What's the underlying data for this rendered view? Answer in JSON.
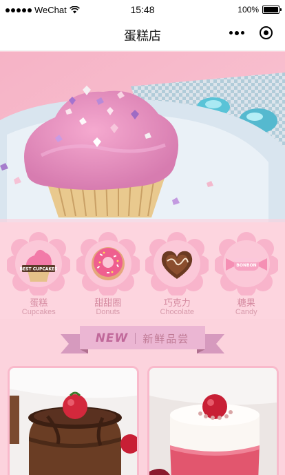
{
  "status_bar": {
    "carrier": "WeChat",
    "time": "15:48",
    "battery": "100%"
  },
  "nav": {
    "title": "蛋糕店"
  },
  "categories": [
    {
      "label_cn": "蛋糕",
      "label_en": "Cupcakes",
      "badge_text": "BEST CUPCAKES",
      "icon": "cupcake-icon"
    },
    {
      "label_cn": "甜甜圈",
      "label_en": "Donuts",
      "icon": "donut-icon"
    },
    {
      "label_cn": "巧克力",
      "label_en": "Chocolate",
      "icon": "chocolate-heart-icon"
    },
    {
      "label_cn": "糖果",
      "label_en": "Candy",
      "badge_text": "BONBON",
      "icon": "candy-icon"
    }
  ],
  "section": {
    "new_label": "NEW",
    "title": "新鲜品尝"
  },
  "colors": {
    "page_bg": "#fcd3dd",
    "accent": "#d58aa0",
    "ribbon": "#ebb6d3"
  }
}
